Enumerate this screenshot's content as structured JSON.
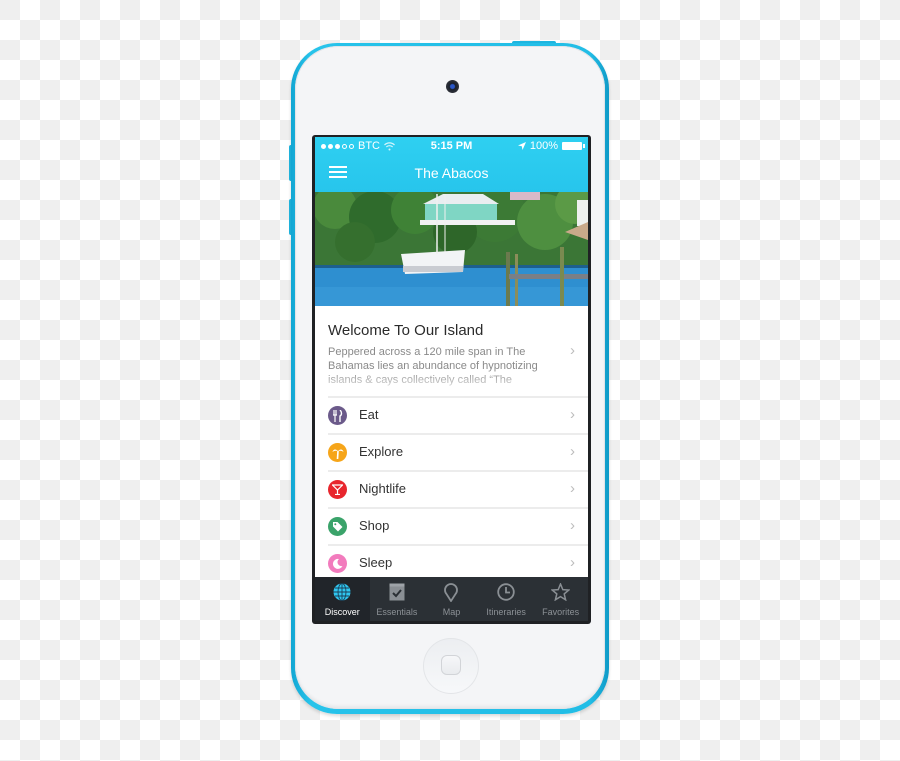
{
  "status_bar": {
    "signal_filled": 3,
    "signal_total": 5,
    "carrier": "BTC",
    "time": "5:15 PM",
    "battery": "100%",
    "icons": [
      "wifi-icon",
      "location-arrow-icon",
      "battery-icon"
    ]
  },
  "nav": {
    "menu_icon": "hamburger-menu-icon",
    "title": "The Abacos"
  },
  "hero": {
    "description": "Photo of a catamaran moored near a dock in front of a turquoise waterfront house"
  },
  "welcome": {
    "title": "Welcome To Our Island",
    "body": "Peppered across a 120 mile span in The Bahamas lies an abundance of hypnotizing islands & cays collectively called “The"
  },
  "categories": [
    {
      "label": "Eat",
      "icon": "fork-knife-icon",
      "color": "#6b5a8a",
      "glyph": "†"
    },
    {
      "label": "Explore",
      "icon": "palm-tree-icon",
      "color": "#f6a519",
      "glyph": "⚘"
    },
    {
      "label": "Nightlife",
      "icon": "cocktail-icon",
      "color": "#e8262d",
      "glyph": "▿"
    },
    {
      "label": "Shop",
      "icon": "tag-icon",
      "color": "#3aa36a",
      "glyph": "◆"
    },
    {
      "label": "Sleep",
      "icon": "moon-icon",
      "color": "#f27bbd",
      "glyph": "☾"
    }
  ],
  "tabs": [
    {
      "label": "Discover",
      "icon": "globe-icon",
      "active": true
    },
    {
      "label": "Essentials",
      "icon": "checkbox-icon",
      "active": false
    },
    {
      "label": "Map",
      "icon": "map-pin-icon",
      "active": false
    },
    {
      "label": "Itineraries",
      "icon": "clock-icon",
      "active": false
    },
    {
      "label": "Favorites",
      "icon": "star-icon",
      "active": false
    }
  ],
  "colors": {
    "accent": "#29c8ee",
    "device_shell": "#22bde6",
    "tab_bar": "#2b3035",
    "tab_active_icon": "#2fc6f0"
  }
}
